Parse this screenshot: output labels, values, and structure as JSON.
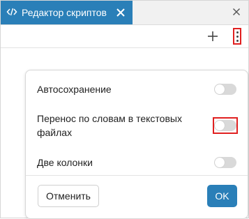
{
  "tab": {
    "title": "Редактор скриптов",
    "icon": "code-icon"
  },
  "colors": {
    "accent": "#2a7fb8",
    "highlight": "#e02020",
    "toggle_off": "#d9d9d9"
  },
  "toolbar": {
    "add_icon": "plus-icon",
    "more_icon": "more-vertical-icon"
  },
  "dialog": {
    "options": [
      {
        "label": "Автосохранение",
        "enabled": false
      },
      {
        "label_line1": "Перенос по словам в текстовых",
        "label_line2": "файлах",
        "enabled": false
      },
      {
        "label": "Две колонки",
        "enabled": false
      }
    ],
    "cancel_label": "Отменить",
    "ok_label": "OK"
  }
}
